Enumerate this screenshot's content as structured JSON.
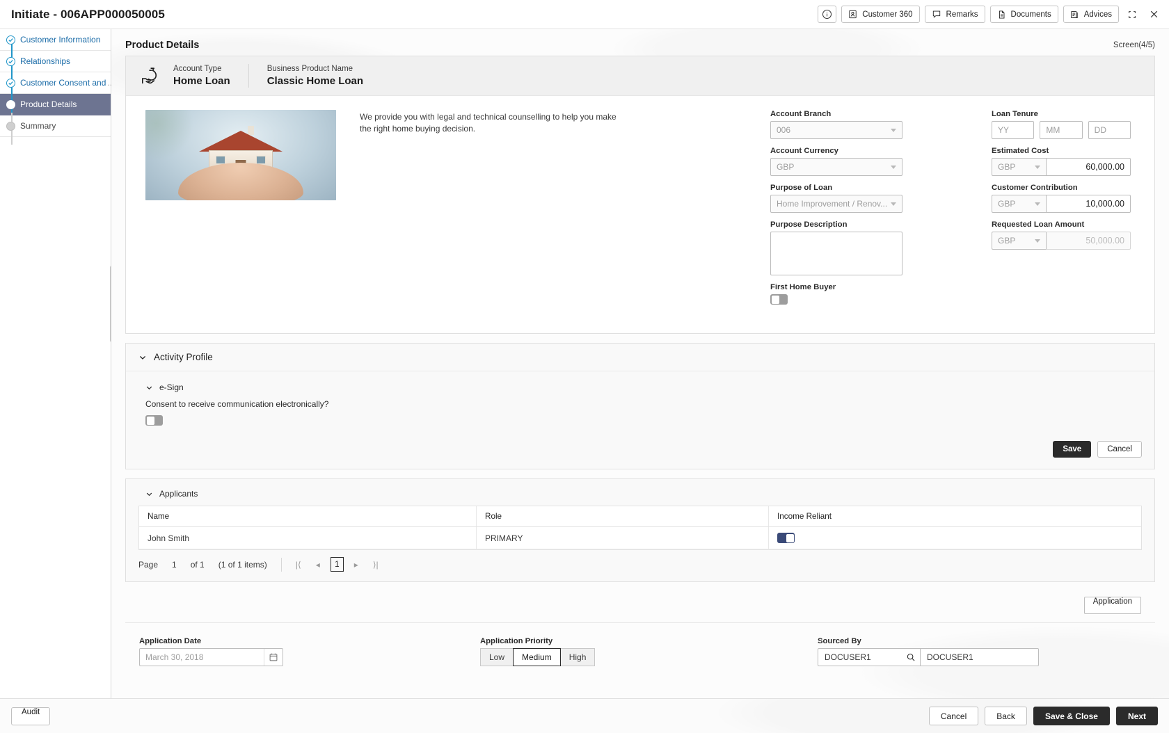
{
  "window": {
    "title": "Initiate - 006APP000050005",
    "minimize_icon": "collapse-icon",
    "close_icon": "close-icon"
  },
  "toolbar": {
    "info_icon": "info-icon",
    "buttons": [
      {
        "label": "Customer 360",
        "icon": "user-card-icon"
      },
      {
        "label": "Remarks",
        "icon": "speech-bubble-icon"
      },
      {
        "label": "Documents",
        "icon": "document-icon"
      },
      {
        "label": "Advices",
        "icon": "advice-icon"
      }
    ]
  },
  "sidebar": {
    "steps": [
      {
        "label": "Customer Information",
        "state": "done"
      },
      {
        "label": "Relationships",
        "state": "done"
      },
      {
        "label": "Customer Consent and",
        "state": "done",
        "ellipsis": "..."
      },
      {
        "label": "Product Details",
        "state": "active"
      },
      {
        "label": "Summary",
        "state": "pending"
      }
    ]
  },
  "page": {
    "title": "Product Details",
    "screen_counter": "Screen(4/5)"
  },
  "product": {
    "icon": "money-bag-hand-icon",
    "account_type_label": "Account Type",
    "account_type_value": "Home Loan",
    "business_product_label": "Business Product Name",
    "business_product_value": "Classic Home Loan",
    "hero_image": "hands-holding-house-photo",
    "description": "We provide you with legal and technical counselling to help you make the right home buying decision."
  },
  "form": {
    "account_branch": {
      "label": "Account Branch",
      "value": "006"
    },
    "account_currency": {
      "label": "Account Currency",
      "value": "GBP"
    },
    "purpose_of_loan": {
      "label": "Purpose of Loan",
      "value": "Home Improvement / Renov..."
    },
    "purpose_description": {
      "label": "Purpose Description",
      "value": ""
    },
    "first_home_buyer": {
      "label": "First Home Buyer",
      "state": "off"
    },
    "loan_tenure": {
      "label": "Loan Tenure",
      "yy_placeholder": "YY",
      "mm_placeholder": "MM",
      "dd_placeholder": "DD",
      "yy_value": "",
      "mm_value": "",
      "dd_value": ""
    },
    "estimated_cost": {
      "label": "Estimated Cost",
      "currency": "GBP",
      "amount": "60,000.00"
    },
    "customer_contribution": {
      "label": "Customer Contribution",
      "currency": "GBP",
      "amount": "10,000.00"
    },
    "requested_loan_amount": {
      "label": "Requested Loan Amount",
      "currency": "GBP",
      "amount": "50,000.00"
    }
  },
  "activity_profile": {
    "title": "Activity Profile",
    "esign": {
      "title": "e-Sign",
      "question": "Consent to receive communication electronically?",
      "state": "off"
    },
    "save_label": "Save",
    "cancel_label": "Cancel"
  },
  "applicants": {
    "title": "Applicants",
    "columns": [
      "Name",
      "Role",
      "Income Reliant"
    ],
    "rows": [
      {
        "name": "John Smith",
        "role": "PRIMARY",
        "income_reliant": "on"
      }
    ],
    "pagination": {
      "page_label": "Page",
      "page_number": "1",
      "of_label": "of 1",
      "items_label": "(1 of 1 items)",
      "first_icon": "first-page-icon",
      "prev_icon": "previous-page-icon",
      "current": "1",
      "next_icon": "next-page-icon",
      "last_icon": "last-page-icon"
    },
    "application_button": "Application"
  },
  "meta": {
    "application_date": {
      "label": "Application Date",
      "value": "March 30, 2018",
      "icon": "calendar-icon"
    },
    "application_priority": {
      "label": "Application Priority",
      "options": [
        "Low",
        "Medium",
        "High"
      ],
      "selected": "Medium"
    },
    "sourced_by": {
      "label": "Sourced By",
      "code": "DOCUSER1",
      "name": "DOCUSER1",
      "search_icon": "search-icon"
    }
  },
  "footer": {
    "audit_label": "Audit",
    "cancel_label": "Cancel",
    "back_label": "Back",
    "save_close_label": "Save & Close",
    "next_label": "Next"
  },
  "colors": {
    "accent_step": "#2196c9",
    "active_step_bg": "#6d7491",
    "dark_button": "#2b2b2b",
    "toggle_on": "#3a4a78"
  }
}
